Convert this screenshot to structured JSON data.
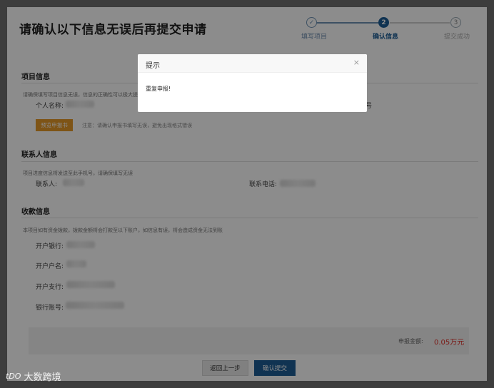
{
  "page": {
    "title": "请确认以下信息无误后再提交申请"
  },
  "steps": [
    {
      "num": "✓",
      "label": "填写项目",
      "state": "done"
    },
    {
      "num": "2",
      "label": "确认信息",
      "state": "active"
    },
    {
      "num": "3",
      "label": "提交成功",
      "state": "pending"
    }
  ],
  "project_info": {
    "title": "项目信息",
    "hint": "请确保填写项目信息无误，信息的正确性可以极大提",
    "name_label": "个人名称:",
    "right_fragment": "号",
    "preview_button": "预览申报书",
    "note": "注意：请确认申报书填写无误，避免出现格式错误"
  },
  "contact_info": {
    "title": "联系人信息",
    "hint": "项目进度信息将发送至此手机号，请确保填写无误",
    "contact_label": "联系人:",
    "phone_label": "联系电话:"
  },
  "payment_info": {
    "title": "收款信息",
    "hint": "本项目如有资金拨款，拨款金额将会打款至以下账户，如信息有误，将会造成资金无法到账",
    "bank_label": "开户银行:",
    "account_name_label": "开户户名:",
    "branch_label": "开户支行:",
    "account_no_label": "银行账号:"
  },
  "summary": {
    "amount_label": "申报金额:",
    "amount_value": "0.05万元"
  },
  "buttons": {
    "back": "返回上一步",
    "submit": "确认提交"
  },
  "modal": {
    "title": "提示",
    "close": "×",
    "message": "重复申报!"
  },
  "watermark": {
    "logo": "tDO",
    "text": "大数跨境"
  },
  "colors": {
    "primary": "#1e5e96",
    "orange": "#e59a28",
    "amount_red": "#e0322b"
  }
}
